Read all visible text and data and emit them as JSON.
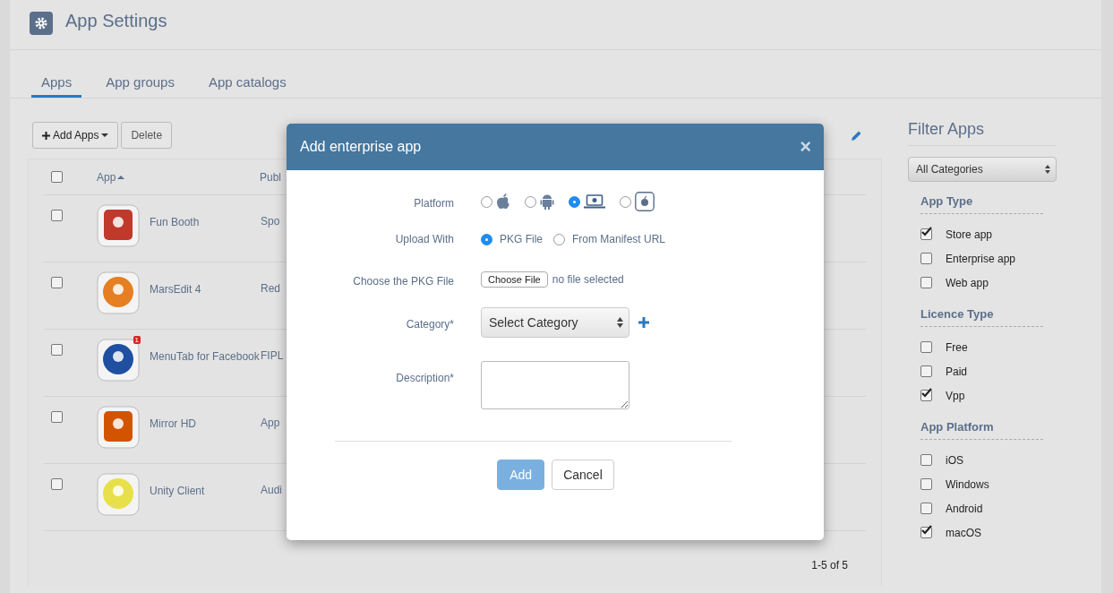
{
  "page": {
    "title": "App Settings"
  },
  "tabs": [
    {
      "label": "Apps",
      "selected": true
    },
    {
      "label": "App groups",
      "selected": false
    },
    {
      "label": "App catalogs",
      "selected": false
    }
  ],
  "toolbar": {
    "add_button": "Add Apps",
    "delete_button": "Delete"
  },
  "table": {
    "columns": [
      "App",
      "Publ"
    ],
    "select_all_checked": false,
    "rows": [
      {
        "name": "Fun Booth",
        "publisher": "Spo",
        "checked": false,
        "kind": "film",
        "badge": ""
      },
      {
        "name": "MarsEdit 4",
        "publisher": "Red",
        "checked": false,
        "kind": "rocket",
        "badge": ""
      },
      {
        "name": "MenuTab for Facebook",
        "publisher": "FIPL",
        "checked": false,
        "kind": "person",
        "badge": "1"
      },
      {
        "name": "Mirror HD",
        "publisher": "App",
        "checked": false,
        "kind": "mirror",
        "badge": ""
      },
      {
        "name": "Unity Client",
        "publisher": "Audi",
        "checked": false,
        "kind": "headset",
        "badge": ""
      }
    ],
    "pagination": "1-5 of 5"
  },
  "filter": {
    "title": "Filter Apps",
    "category": "All Categories",
    "groups": [
      {
        "title": "App Type",
        "options": [
          {
            "label": "Store app",
            "checked": true
          },
          {
            "label": "Enterprise app",
            "checked": false
          },
          {
            "label": "Web app",
            "checked": false
          }
        ]
      },
      {
        "title": "Licence Type",
        "options": [
          {
            "label": "Free",
            "checked": false
          },
          {
            "label": "Paid",
            "checked": false
          },
          {
            "label": "Vpp",
            "checked": true
          }
        ]
      },
      {
        "title": "App Platform",
        "options": [
          {
            "label": "iOS",
            "checked": false
          },
          {
            "label": "Windows",
            "checked": false
          },
          {
            "label": "Android",
            "checked": false
          },
          {
            "label": "macOS",
            "checked": true
          }
        ]
      }
    ]
  },
  "dialog": {
    "title": "Add enterprise app",
    "close": "×",
    "platform_label": "Platform",
    "platforms": [
      {
        "kind": "apple",
        "selected": false
      },
      {
        "kind": "android",
        "selected": false
      },
      {
        "kind": "laptop",
        "selected": true
      },
      {
        "kind": "apple-box",
        "selected": false
      }
    ],
    "upload_label": "Upload With",
    "upload_options": [
      {
        "label": "PKG File",
        "selected": true
      },
      {
        "label": "From Manifest URL",
        "selected": false
      }
    ],
    "file_label": "Choose the PKG File",
    "file_button": "Choose File",
    "file_status": "no file selected",
    "category_label": "Category*",
    "category_value": "Select Category",
    "description_label": "Description*",
    "buttons": {
      "primary": "Add",
      "secondary": "Cancel"
    }
  }
}
